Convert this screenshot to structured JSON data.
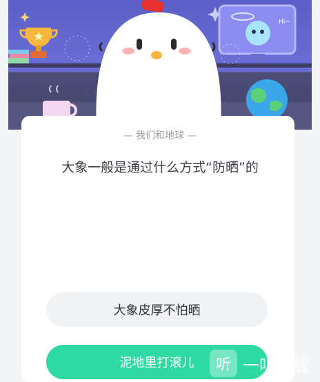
{
  "quiz": {
    "category": "— 我们和地球 —",
    "question": "大象一般是通过什么方式“防晒”的",
    "options": [
      {
        "label": "大象皮厚不怕晒"
      },
      {
        "label": "泥地里打滚儿"
      }
    ]
  },
  "watermark": {
    "badge": "听",
    "text": "一听下载"
  },
  "banner": {
    "characters": [
      "chicken-mascot",
      "robot-mascot",
      "trophy",
      "globe",
      "mug"
    ],
    "robot_speech": "Hi~"
  }
}
